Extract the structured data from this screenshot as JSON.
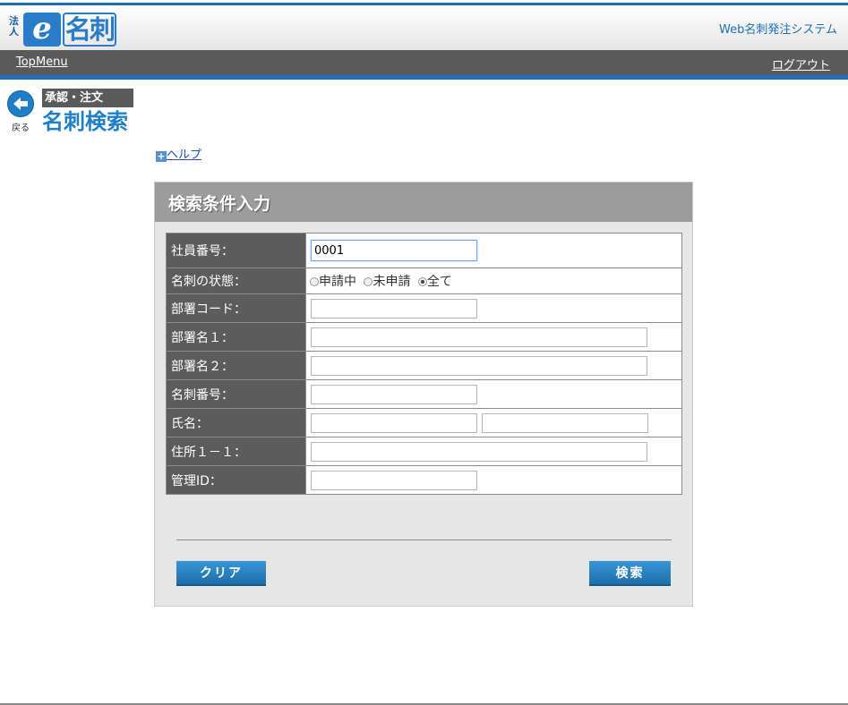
{
  "header": {
    "logo_hojin": "法人",
    "logo_e": "e",
    "logo_meishi": "名刺",
    "system_name": "Web名刺発注システム"
  },
  "nav": {
    "top_menu": "TopMenu",
    "logout": "ログアウト"
  },
  "back": {
    "label": "戻る"
  },
  "breadcrumb": "承認・注文",
  "page_title": "名刺検索",
  "help": {
    "icon": "+",
    "label": "ヘルプ"
  },
  "panel": {
    "title": "検索条件入力",
    "fields": {
      "employee_no": {
        "label": "社員番号：",
        "value": "0001"
      },
      "card_status": {
        "label": "名刺の状態：",
        "options": [
          "申請中",
          "未申請",
          "全て"
        ],
        "selected": "全て"
      },
      "dept_code": {
        "label": "部署コード：",
        "value": ""
      },
      "dept_name1": {
        "label": "部署名１：",
        "value": ""
      },
      "dept_name2": {
        "label": "部署名２：",
        "value": ""
      },
      "card_no": {
        "label": "名刺番号：",
        "value": ""
      },
      "name": {
        "label": "氏名：",
        "last_value": "",
        "first_value": ""
      },
      "address": {
        "label": "住所１－１：",
        "value": ""
      },
      "manage_id": {
        "label": "管理ID：",
        "value": ""
      }
    },
    "clear_button": "クリア",
    "search_button": "検索"
  },
  "colors": {
    "accent": "#1e6fb8",
    "nav_bg": "#5a5a5a",
    "title": "#1e7fc8",
    "panel_head": "#9c9c9c",
    "label_bg": "#5c5c5c"
  }
}
